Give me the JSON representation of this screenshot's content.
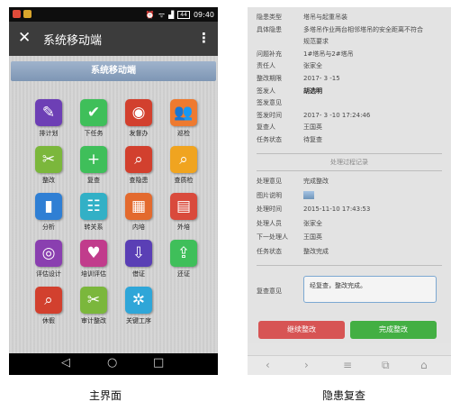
{
  "phone1": {
    "statusbar": {
      "time": "09:40",
      "battery": "44",
      "alarm_icon": "⏰",
      "wifi_icon": "ᯤ",
      "signal_icon": "▟"
    },
    "appbar": {
      "close_icon": "✕",
      "title": "系统移动端",
      "more_icon": "⋮"
    },
    "banner": "系统移动端",
    "tiles": [
      {
        "label": "排计划",
        "icon": "✎",
        "color": "#6d3fb5"
      },
      {
        "label": "下任务",
        "icon": "✔",
        "color": "#3fbf5a"
      },
      {
        "label": "发督办",
        "icon": "◉",
        "color": "#d2402e"
      },
      {
        "label": "巡检",
        "icon": "👥",
        "color": "#ee7a2f"
      },
      {
        "label": "整改",
        "icon": "✂",
        "color": "#7bb73c"
      },
      {
        "label": "复查",
        "icon": "+",
        "color": "#3fbf5a"
      },
      {
        "label": "查隐患",
        "icon": "⌕",
        "color": "#d2402e"
      },
      {
        "label": "查质检",
        "icon": "⌕",
        "color": "#f0a420"
      },
      {
        "label": "分析",
        "icon": "▮",
        "color": "#2f7fd4"
      },
      {
        "label": "转关系",
        "icon": "☷",
        "color": "#32b0c6"
      },
      {
        "label": "内培",
        "icon": "▦",
        "color": "#e36a2e"
      },
      {
        "label": "外培",
        "icon": "▤",
        "color": "#d94a3c"
      },
      {
        "label": "评估设计",
        "icon": "◎",
        "color": "#8a3fb0"
      },
      {
        "label": "培训评估",
        "icon": "♥",
        "color": "#c13c8c"
      },
      {
        "label": "借证",
        "icon": "⇩",
        "color": "#5a3fb5"
      },
      {
        "label": "还证",
        "icon": "⇪",
        "color": "#3fbf5a"
      },
      {
        "label": "休假",
        "icon": "⌕",
        "color": "#d2402e"
      },
      {
        "label": "审计整改",
        "icon": "✂",
        "color": "#7bb73c"
      },
      {
        "label": "关键工序",
        "icon": "✲",
        "color": "#2fa6d8"
      }
    ],
    "navbar": {
      "back_icon": "◁",
      "home_icon": "○",
      "recent_icon": "□"
    }
  },
  "phone2": {
    "rows_top": [
      {
        "k": "隐患类型",
        "v": "塔吊与起重吊装"
      },
      {
        "k": "具体隐患",
        "v": "多塔吊作业两台相邻塔吊的安全距离不符合"
      },
      {
        "k": "",
        "v": "规范要求"
      },
      {
        "k": "问题补充",
        "v": "1#塔吊与2#塔吊"
      },
      {
        "k": "责任人",
        "v": "张家全"
      },
      {
        "k": "整改期限",
        "v": "2017- 3 -15"
      },
      {
        "k": "签发人",
        "v": "胡选明"
      },
      {
        "k": "签发意见",
        "v": ""
      },
      {
        "k": "签发时间",
        "v": "2017- 3 -10 17:24:46"
      },
      {
        "k": "复查人",
        "v": "王国英"
      },
      {
        "k": "任务状态",
        "v": "待复查"
      }
    ],
    "section_title": "处理过程记录",
    "rows_bottom": [
      {
        "k": "处理意见",
        "v": "完成整改"
      },
      {
        "k": "图片说明",
        "v": ""
      },
      {
        "k": "处理时间",
        "v": "2015-11-10 17:43:53"
      },
      {
        "k": "处理人员",
        "v": "张家全"
      },
      {
        "k": "下一处理人",
        "v": "王国英"
      },
      {
        "k": "任务状态",
        "v": "整改完成"
      }
    ],
    "review_label": "复查意见",
    "review_value": "经复查，整改完成。",
    "continue_button": "继续整改",
    "finish_button": "完成整改",
    "navbar": {
      "back_icon": "‹",
      "forward_icon": "›",
      "menu_icon": "≡",
      "tabs_icon": "⧉",
      "home_icon": "⌂"
    }
  },
  "captions": {
    "left": "主界面",
    "right": "隐患复查"
  }
}
